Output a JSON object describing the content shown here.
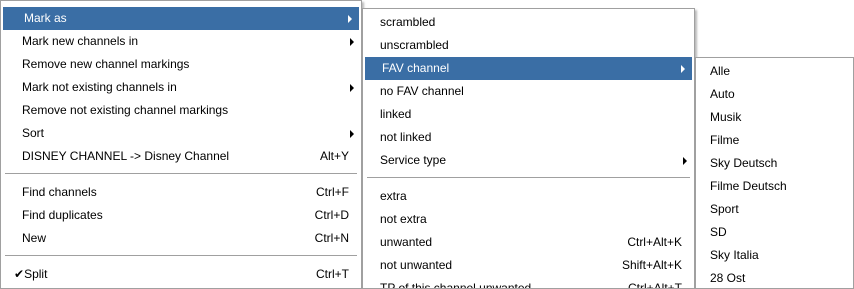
{
  "menu1": {
    "items": [
      {
        "label": "Mark as",
        "shortcut": "",
        "submenu": true,
        "selected": true
      },
      {
        "label": "Mark new channels in",
        "shortcut": "",
        "submenu": true
      },
      {
        "label": "Remove new channel markings",
        "shortcut": ""
      },
      {
        "label": "Mark not existing channels in",
        "shortcut": "",
        "submenu": true
      },
      {
        "label": "Remove not existing channel markings",
        "shortcut": ""
      },
      {
        "label": "Sort",
        "shortcut": "",
        "submenu": true
      },
      {
        "label": "DISNEY CHANNEL -> Disney Channel",
        "shortcut": "Alt+Y"
      },
      {
        "label": "Find channels",
        "shortcut": "Ctrl+F"
      },
      {
        "label": "Find duplicates",
        "shortcut": "Ctrl+D"
      },
      {
        "label": "New",
        "shortcut": "Ctrl+N"
      },
      {
        "label": "Split",
        "shortcut": "Ctrl+T",
        "checked": true
      }
    ],
    "check_glyph": "✔"
  },
  "menu2": {
    "items": [
      {
        "label": "scrambled",
        "shortcut": ""
      },
      {
        "label": "unscrambled",
        "shortcut": ""
      },
      {
        "label": "FAV channel",
        "shortcut": "",
        "submenu": true,
        "selected": true
      },
      {
        "label": "no FAV channel",
        "shortcut": ""
      },
      {
        "label": "linked",
        "shortcut": ""
      },
      {
        "label": "not linked",
        "shortcut": ""
      },
      {
        "label": "Service type",
        "shortcut": "",
        "submenu": true
      },
      {
        "label": "extra",
        "shortcut": ""
      },
      {
        "label": "not extra",
        "shortcut": ""
      },
      {
        "label": "unwanted",
        "shortcut": "Ctrl+Alt+K"
      },
      {
        "label": "not unwanted",
        "shortcut": "Shift+Alt+K"
      },
      {
        "label": "TP of this channel unwanted",
        "shortcut": "Ctrl+Alt+T"
      }
    ]
  },
  "menu3": {
    "items": [
      {
        "label": "Alle"
      },
      {
        "label": "Auto"
      },
      {
        "label": "Musik"
      },
      {
        "label": "Filme"
      },
      {
        "label": "Sky Deutsch"
      },
      {
        "label": "Filme Deutsch"
      },
      {
        "label": "Sport"
      },
      {
        "label": "SD"
      },
      {
        "label": "Sky Italia"
      },
      {
        "label": "28 Ost"
      }
    ]
  },
  "colors": {
    "selection": "#3a6ea5",
    "border": "#a0a0a0"
  }
}
